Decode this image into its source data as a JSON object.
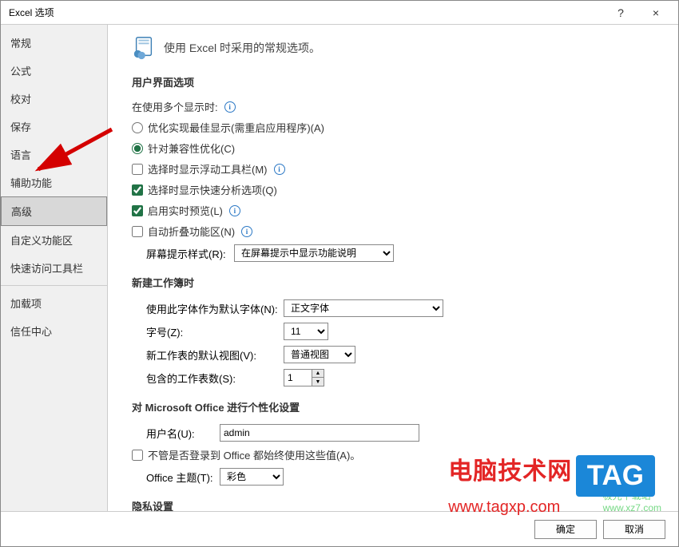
{
  "window": {
    "title": "Excel 选项",
    "help": "?",
    "close": "×"
  },
  "sidebar": {
    "items": [
      {
        "label": "常规",
        "selected": false
      },
      {
        "label": "公式",
        "selected": false
      },
      {
        "label": "校对",
        "selected": false
      },
      {
        "label": "保存",
        "selected": false
      },
      {
        "label": "语言",
        "selected": false
      },
      {
        "label": "辅助功能",
        "selected": false
      },
      {
        "label": "高级",
        "selected": true
      },
      {
        "label": "自定义功能区",
        "selected": false
      },
      {
        "label": "快速访问工具栏",
        "selected": false
      },
      {
        "label": "加载项",
        "selected": false
      },
      {
        "label": "信任中心",
        "selected": false
      }
    ]
  },
  "header": {
    "text": "使用 Excel 时采用的常规选项。"
  },
  "sections": {
    "ui": "用户界面选项",
    "newbook": "新建工作簿时",
    "personalize": "对 Microsoft Office 进行个性化设置",
    "privacy": "隐私设置"
  },
  "ui_options": {
    "multi_monitor_label": "在使用多个显示时:",
    "radio_best": "优化实现最佳显示(需重启应用程序)(A)",
    "radio_compat": "针对兼容性优化(C)",
    "show_mini_toolbar": "选择时显示浮动工具栏(M)",
    "show_quick_analysis": "选择时显示快速分析选项(Q)",
    "live_preview": "启用实时预览(L)",
    "collapse_ribbon": "自动折叠功能区(N)",
    "screentip_label": "屏幕提示样式(R):",
    "screentip_value": "在屏幕提示中显示功能说明"
  },
  "newbook": {
    "font_label": "使用此字体作为默认字体(N):",
    "font_value": "正文字体",
    "size_label": "字号(Z):",
    "size_value": "11",
    "view_label": "新工作表的默认视图(V):",
    "view_value": "普通视图",
    "sheets_label": "包含的工作表数(S):",
    "sheets_value": "1"
  },
  "personalize": {
    "username_label": "用户名(U):",
    "username_value": "admin",
    "always_use": "不管是否登录到 Office 都始终使用这些值(A)。",
    "theme_label": "Office 主题(T):",
    "theme_value": "彩色"
  },
  "footer": {
    "ok": "确定",
    "cancel": "取消"
  },
  "watermark": {
    "title": "电脑技术网",
    "tag": "TAG",
    "url": "www.tagxp.com",
    "site2": "极光下载站",
    "site2url": "www.xz7.com"
  }
}
